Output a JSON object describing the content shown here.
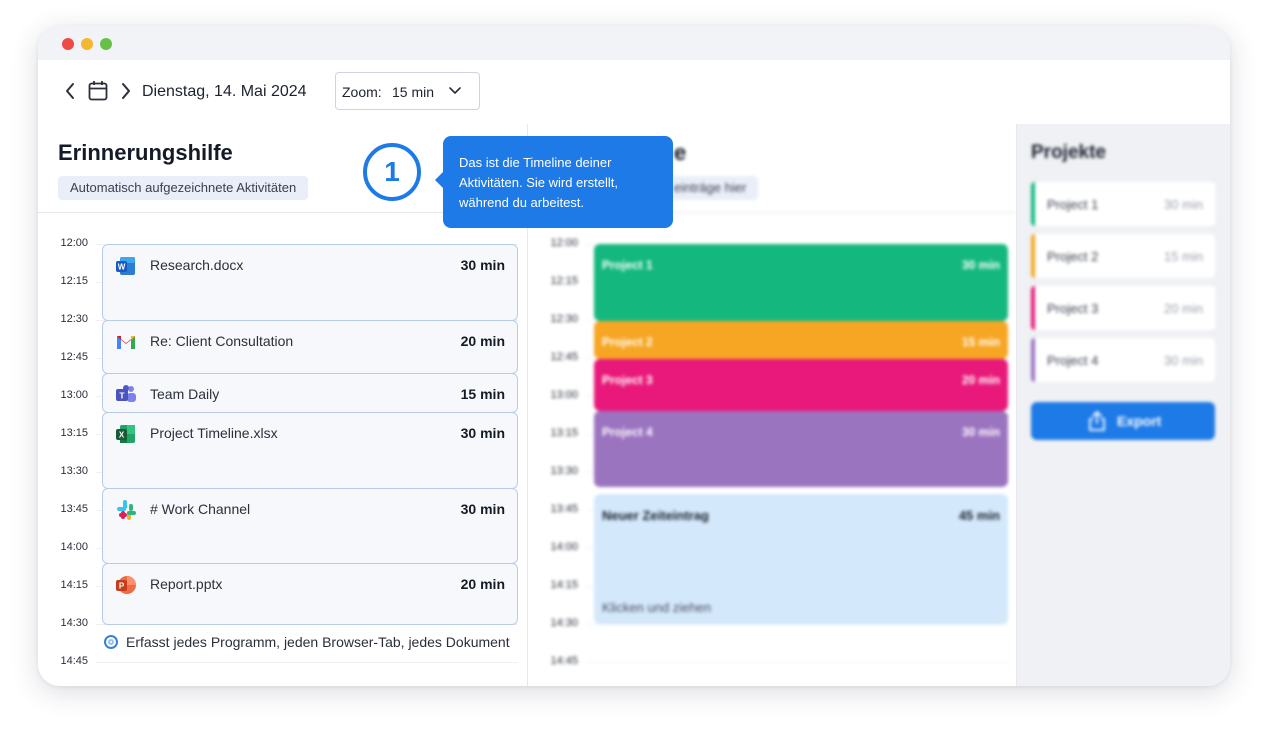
{
  "toolbar": {
    "date": "Dienstag, 14. Mai 2024",
    "zoom_label": "Zoom:",
    "zoom_value": "15 min"
  },
  "left": {
    "title": "Erinnerungshilfe",
    "chip": "Automatisch aufgezeichnete Aktivitäten",
    "times": [
      "12:00",
      "12:15",
      "12:30",
      "12:45",
      "13:00",
      "13:15",
      "13:30",
      "13:45",
      "14:00",
      "14:15",
      "14:30",
      "14:45"
    ],
    "activities": [
      {
        "name": "Research.docx",
        "duration": "30 min",
        "icon": "word-icon"
      },
      {
        "name": "Re: Client Consultation",
        "duration": "20 min",
        "icon": "gmail-icon"
      },
      {
        "name": "Team Daily",
        "duration": "15 min",
        "icon": "teams-icon"
      },
      {
        "name": "Project Timeline.xlsx",
        "duration": "30 min",
        "icon": "excel-icon"
      },
      {
        "name": "# Work Channel",
        "duration": "30 min",
        "icon": "slack-icon"
      },
      {
        "name": "Report.pptx",
        "duration": "20 min",
        "icon": "powerpoint-icon"
      }
    ],
    "caption": "Erfasst jedes Programm, jeden Browser-Tab, jedes Dokument"
  },
  "middle": {
    "title_fragment": "e",
    "chip_fragment": "einträge hier",
    "times": [
      "12:00",
      "12:15",
      "12:30",
      "12:45",
      "13:00",
      "13:15",
      "13:30",
      "13:45",
      "14:00",
      "14:15",
      "14:30",
      "14:45"
    ],
    "blocks": [
      {
        "name": "Project 1",
        "duration": "30 min",
        "color": "#14b87f"
      },
      {
        "name": "Project 2",
        "duration": "15 min",
        "color": "#f6a623"
      },
      {
        "name": "Project 3",
        "duration": "20 min",
        "color": "#e8197a"
      },
      {
        "name": "Project 4",
        "duration": "30 min",
        "color": "#9b74c0"
      }
    ],
    "new_entry": {
      "title": "Neuer Zeiteintrag",
      "duration": "45 min",
      "hint": "Klicken und ziehen"
    }
  },
  "right": {
    "title": "Projekte",
    "projects": [
      {
        "name": "Project 1",
        "duration": "30 min",
        "color": "#14b87f"
      },
      {
        "name": "Project 2",
        "duration": "15 min",
        "color": "#f6a623"
      },
      {
        "name": "Project 3",
        "duration": "20 min",
        "color": "#e8197a"
      },
      {
        "name": "Project 4",
        "duration": "30 min",
        "color": "#9b74c0"
      }
    ],
    "export_label": "Export"
  },
  "tour": {
    "step": "1",
    "text": "Das ist die Timeline deiner Aktivitäten. Sie wird erstellt, während du arbeitest."
  }
}
